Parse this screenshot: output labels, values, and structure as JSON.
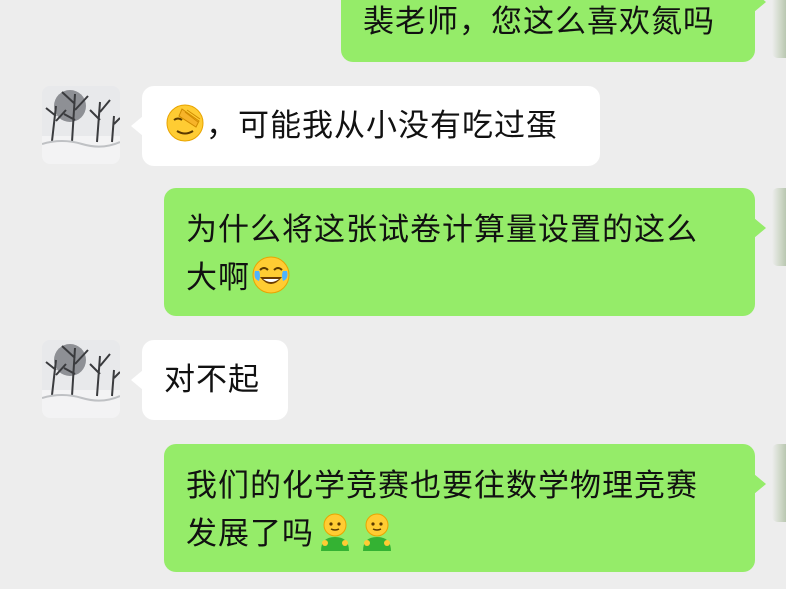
{
  "messages": [
    {
      "side": "right",
      "text": "裴老师，您这么喜欢氮吗",
      "emoji_after": []
    },
    {
      "side": "left",
      "emoji_before": [
        "facepalm-emoji"
      ],
      "text": "，可能我从小没有吃过蛋"
    },
    {
      "side": "right",
      "line1": "为什么将这张试卷计算量设置的这么",
      "line2": "大啊",
      "emoji_after": [
        "tears-of-joy-emoji"
      ]
    },
    {
      "side": "left",
      "text": "对不起"
    },
    {
      "side": "right",
      "line1": "我们的化学竞赛也要往数学物理竞赛",
      "line2": "发展了吗",
      "emoji_after": [
        "green-person-emoji",
        "green-person-emoji"
      ]
    }
  ],
  "colors": {
    "chat_background": "#ededed",
    "incoming_bubble": "#ffffff",
    "outgoing_bubble": "#95ec69",
    "text": "#111111"
  },
  "icons": {
    "contact_avatar": "snowy-tree-photo-avatar"
  }
}
